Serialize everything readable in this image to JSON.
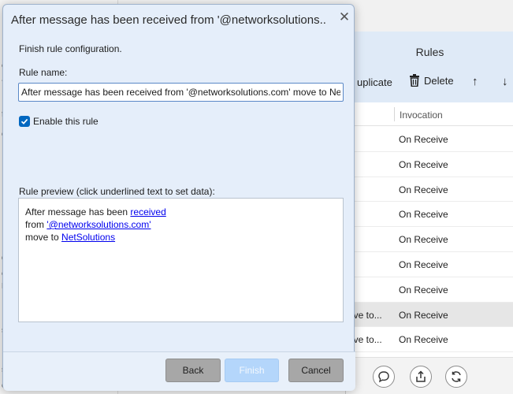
{
  "dialog": {
    "title": "After message has been received from '@networksolutions....",
    "close_glyph": "✕",
    "subtitle": "Finish rule configuration.",
    "rule_name_label": "Rule name:",
    "rule_name_value": "After message has been received from '@networksolutions.com' move to Net",
    "enable_label": "Enable this rule",
    "enable_checked": true,
    "preview_label": "Rule preview (click underlined text to set data):",
    "preview": {
      "line1_text": "After message has been ",
      "line1_link": "received",
      "line2_text": "from ",
      "line2_link": "'@networksolutions.com'",
      "line3_text": "move to ",
      "line3_link": "NetSolutions"
    },
    "buttons": {
      "back": "Back",
      "finish": "Finish",
      "cancel": "Cancel"
    },
    "accent_color": "#0067c0",
    "link_color": "#0000ee"
  },
  "rules_window": {
    "title": "Rules",
    "toolbar": {
      "duplicate": "uplicate",
      "delete": "Delete"
    },
    "column_invocation": "Invocation",
    "rows": [
      {
        "name": "",
        "invocation": "On Receive"
      },
      {
        "name": "",
        "invocation": "On Receive"
      },
      {
        "name": "",
        "invocation": "On Receive"
      },
      {
        "name": "",
        "invocation": "On Receive"
      },
      {
        "name": "",
        "invocation": "On Receive"
      },
      {
        "name": "",
        "invocation": "On Receive"
      },
      {
        "name": "",
        "invocation": "On Receive"
      },
      {
        "name": "ove to...",
        "invocation": "On Receive"
      },
      {
        "name": "ove to...",
        "invocation": "On Receive"
      }
    ],
    "selected_row": 7
  },
  "left_fragments": [
    "e",
    "-",
    "f",
    "o",
    "d",
    "e",
    "N",
    "s",
    "s",
    "c"
  ]
}
